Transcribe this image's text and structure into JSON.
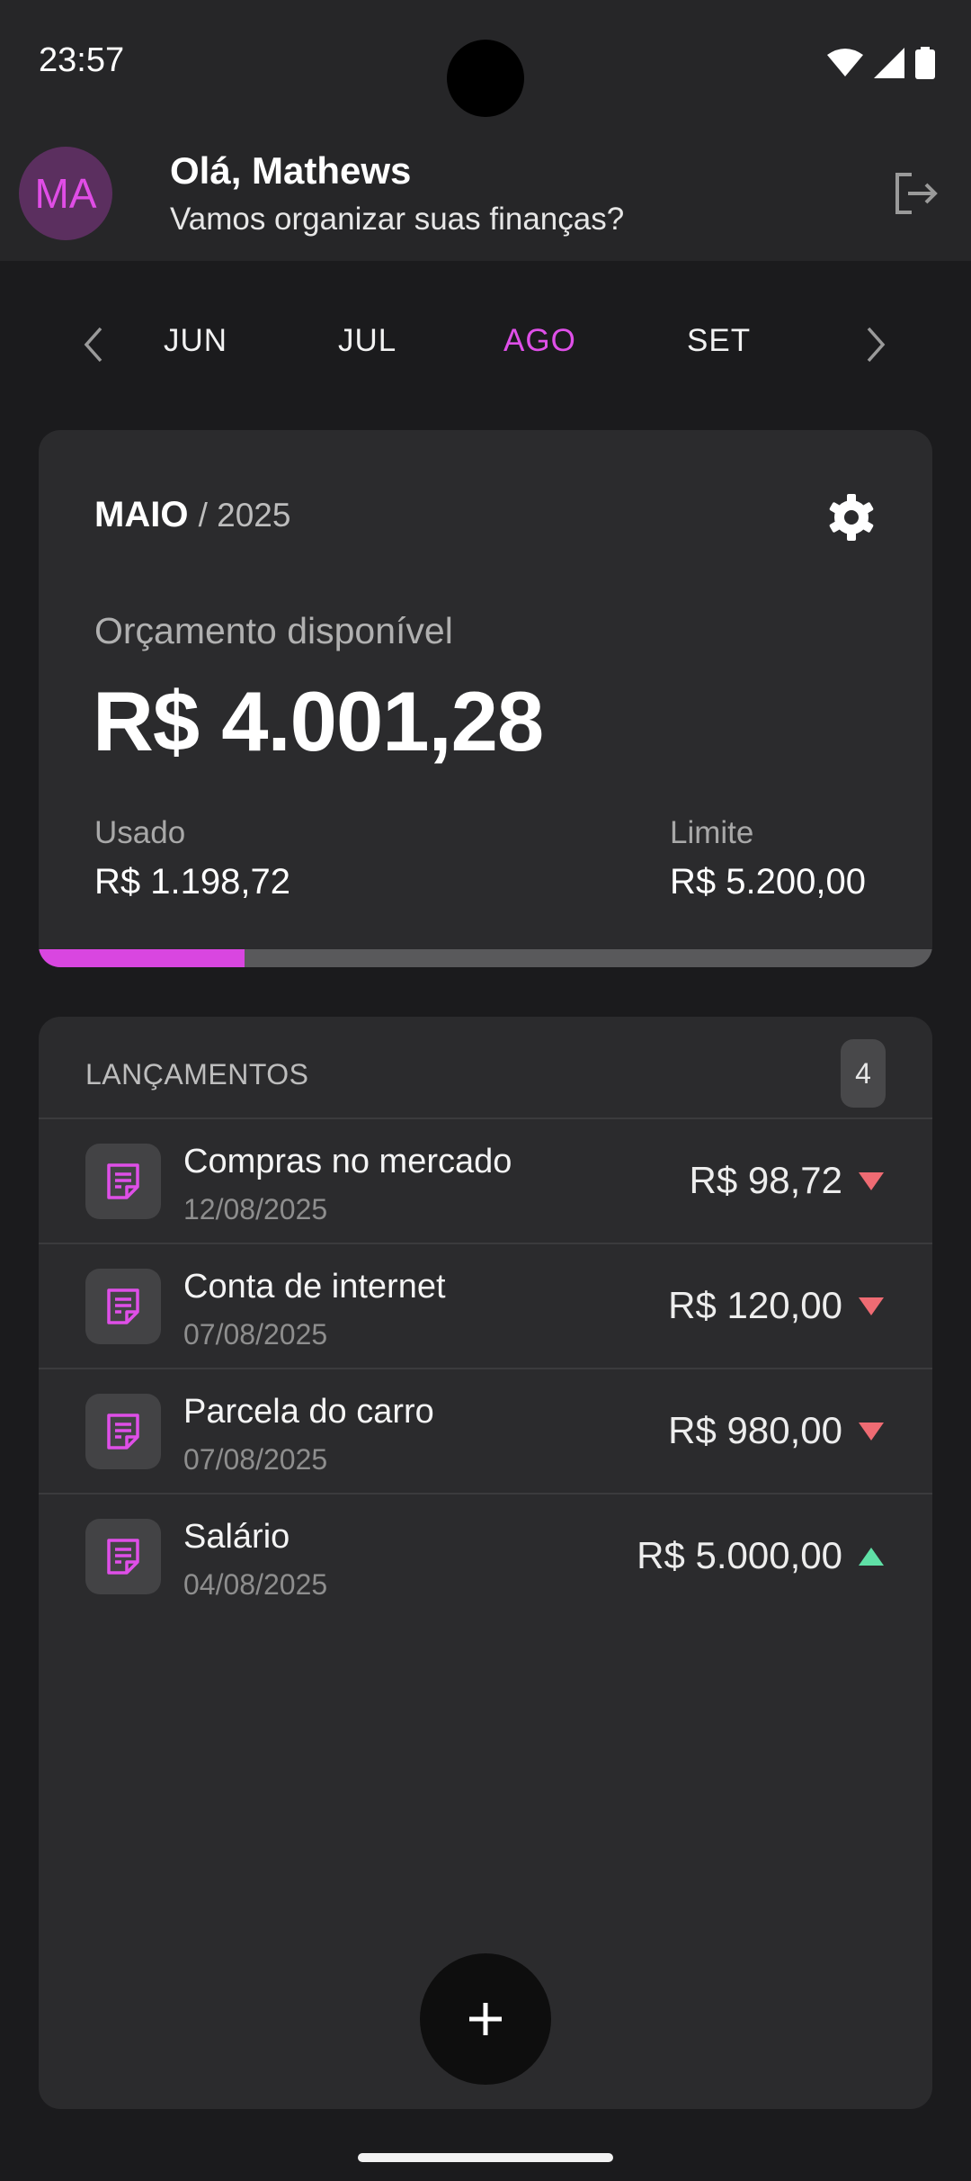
{
  "status_bar": {
    "time": "23:57"
  },
  "header": {
    "avatar_initials": "MA",
    "greeting": "Olá, Mathews",
    "subtitle": "Vamos organizar suas finanças?"
  },
  "month_nav": {
    "months": [
      "JUN",
      "JUL",
      "AGO",
      "SET"
    ],
    "active_month": "AGO"
  },
  "budget": {
    "month": "MAIO",
    "year_separator": "/ 2025",
    "available_label": "Orçamento disponível",
    "available_value": "R$ 4.001,28",
    "used_label": "Usado",
    "used_value": "R$ 1.198,72",
    "limit_label": "Limite",
    "limit_value": "R$ 5.200,00",
    "used_fraction": 0.2305
  },
  "transactions": {
    "title": "LANÇAMENTOS",
    "count": "4",
    "items": [
      {
        "name": "Compras no mercado",
        "date": "12/08/2025",
        "amount": "R$ 98,72",
        "direction": "down"
      },
      {
        "name": "Conta de internet",
        "date": "07/08/2025",
        "amount": "R$ 120,00",
        "direction": "down"
      },
      {
        "name": "Parcela do carro",
        "date": "07/08/2025",
        "amount": "R$ 980,00",
        "direction": "down"
      },
      {
        "name": "Salário",
        "date": "04/08/2025",
        "amount": "R$ 5.000,00",
        "direction": "up"
      }
    ]
  },
  "colors": {
    "accent": "#df4fe8",
    "expense": "#ef6b73",
    "income": "#5fe0a6"
  },
  "icons": [
    "wifi-icon",
    "signal-icon",
    "battery-icon",
    "logout-icon",
    "chevron-left-icon",
    "chevron-right-icon",
    "gear-icon",
    "receipt-icon",
    "plus-icon"
  ]
}
